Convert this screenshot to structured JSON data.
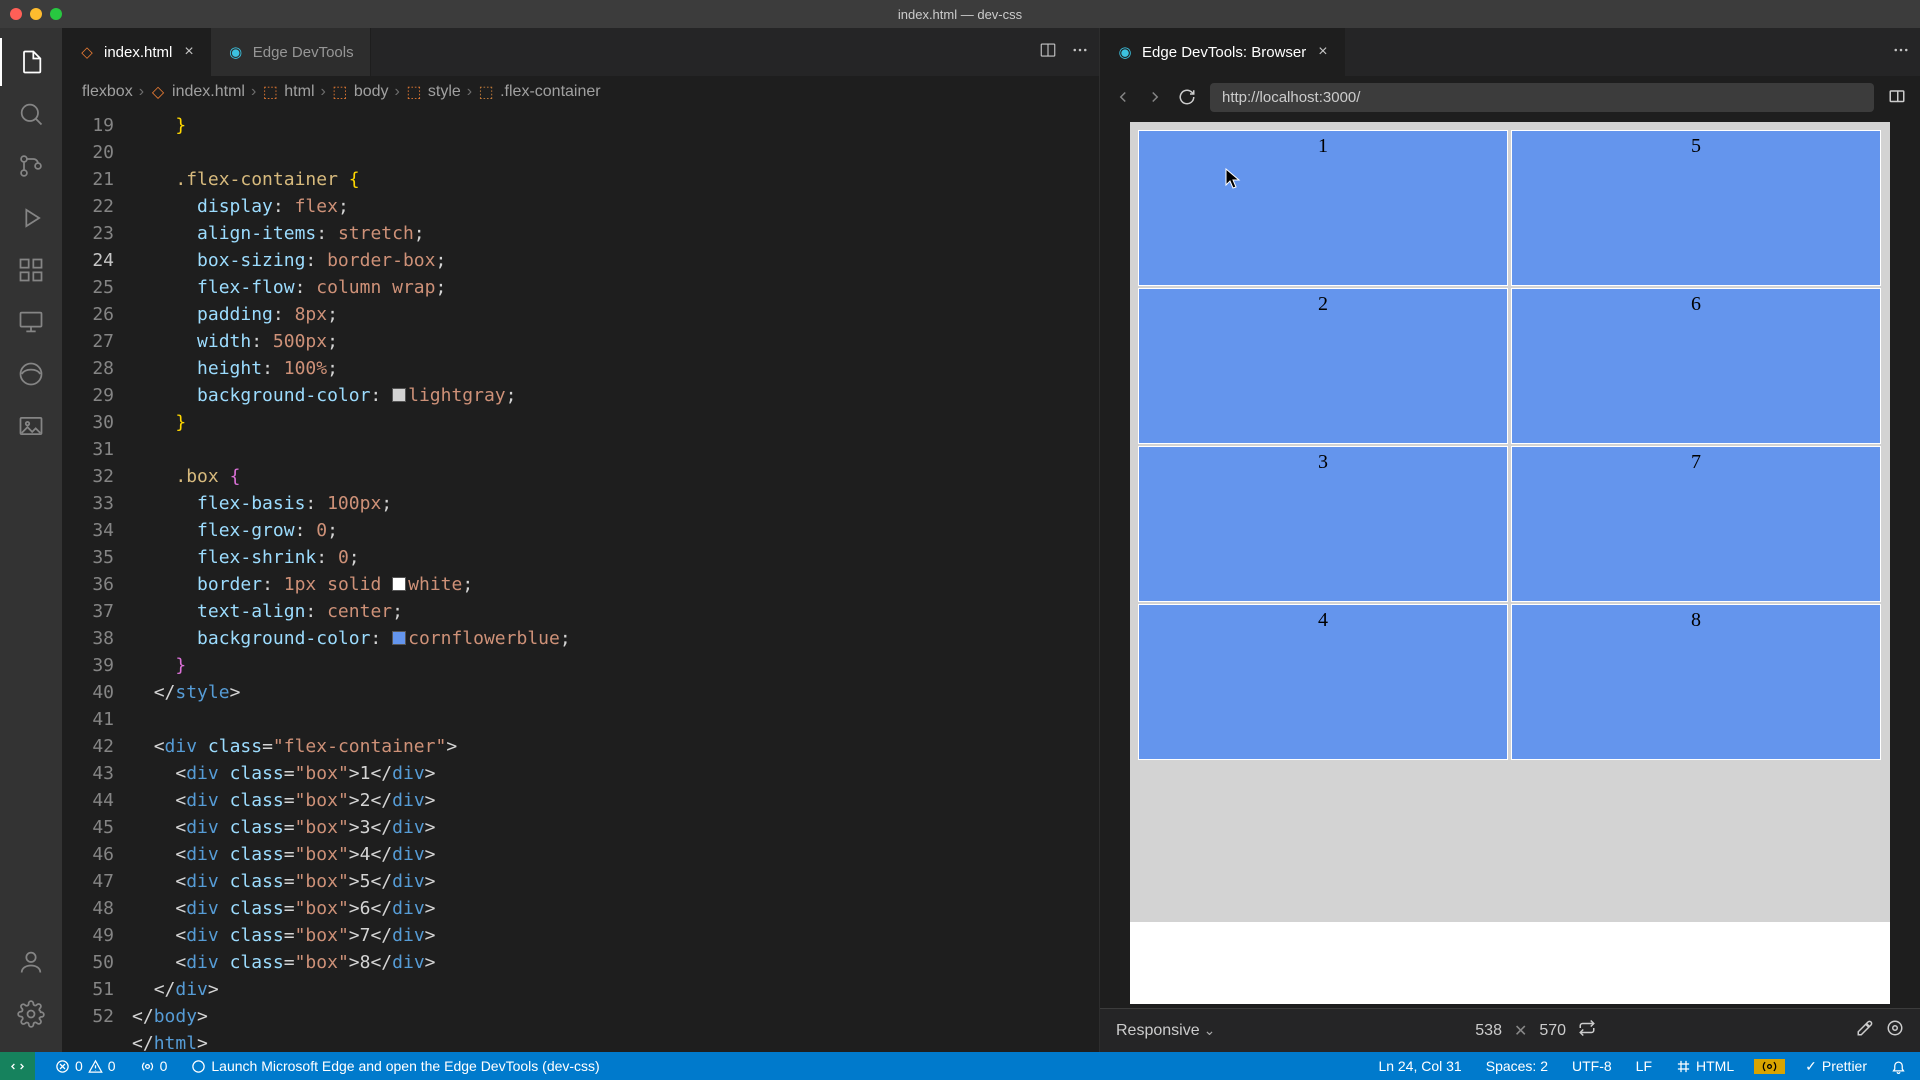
{
  "window_title": "index.html — dev-css",
  "tabs": {
    "active": {
      "label": "index.html",
      "icon": "html-file-icon"
    },
    "second": {
      "label": "Edge DevTools",
      "icon": "edge-icon"
    }
  },
  "preview_tab": {
    "label": "Edge DevTools: Browser",
    "icon": "edge-icon"
  },
  "breadcrumbs": {
    "root": "flexbox",
    "file": "index.html",
    "p1": "html",
    "p2": "body",
    "p3": "style",
    "p4": ".flex-container"
  },
  "lines": {
    "start": 19,
    "end": 52
  },
  "code": {
    "l19": "}",
    "l20_sel": ".flex-container",
    "l21_p": "display",
    "l21_v": "flex",
    "l22_p": "align-items",
    "l22_v": "stretch",
    "l23_p": "box-sizing",
    "l23_v": "border-box",
    "l24_p": "flex-flow",
    "l24_v": "column wrap",
    "l25_p": "padding",
    "l25_v": "8px",
    "l26_p": "width",
    "l26_v": "500px",
    "l27_p": "height",
    "l27_v": "100%",
    "l28_p": "background-color",
    "l28_v": "lightgray",
    "l31_sel": ".box",
    "l32_p": "flex-basis",
    "l32_v": "100px",
    "l33_p": "flex-grow",
    "l33_v": "0",
    "l34_p": "flex-shrink",
    "l34_v": "0",
    "l35_p": "border",
    "l35_v1": "1px",
    "l35_v2": "solid",
    "l35_v3": "white",
    "l36_p": "text-align",
    "l36_v": "center",
    "l37_p": "background-color",
    "l37_v": "cornflowerblue",
    "l39": "style",
    "l41_cls": "flex-container",
    "box_cls": "box",
    "boxes": [
      "1",
      "2",
      "3",
      "4",
      "5",
      "6",
      "7",
      "8"
    ],
    "l51": "body",
    "l52": "html"
  },
  "url": "http://localhost:3000/",
  "preview_boxes": [
    "1",
    "2",
    "3",
    "4",
    "5",
    "6",
    "7",
    "8"
  ],
  "preview_footer": {
    "mode": "Responsive",
    "w": "538",
    "h": "570"
  },
  "status": {
    "remote": "",
    "errors": "0",
    "warnings": "0",
    "ports": "0",
    "msg": "Launch Microsoft Edge and open the Edge DevTools (dev-css)",
    "cursor": "Ln 24, Col 31",
    "spaces": "Spaces: 2",
    "encoding": "UTF-8",
    "eol": "LF",
    "lang": "HTML",
    "prettier": "Prettier"
  },
  "colors": {
    "lightgray": "#d3d3d3",
    "white": "#ffffff",
    "cornflowerblue": "#6495ed"
  }
}
